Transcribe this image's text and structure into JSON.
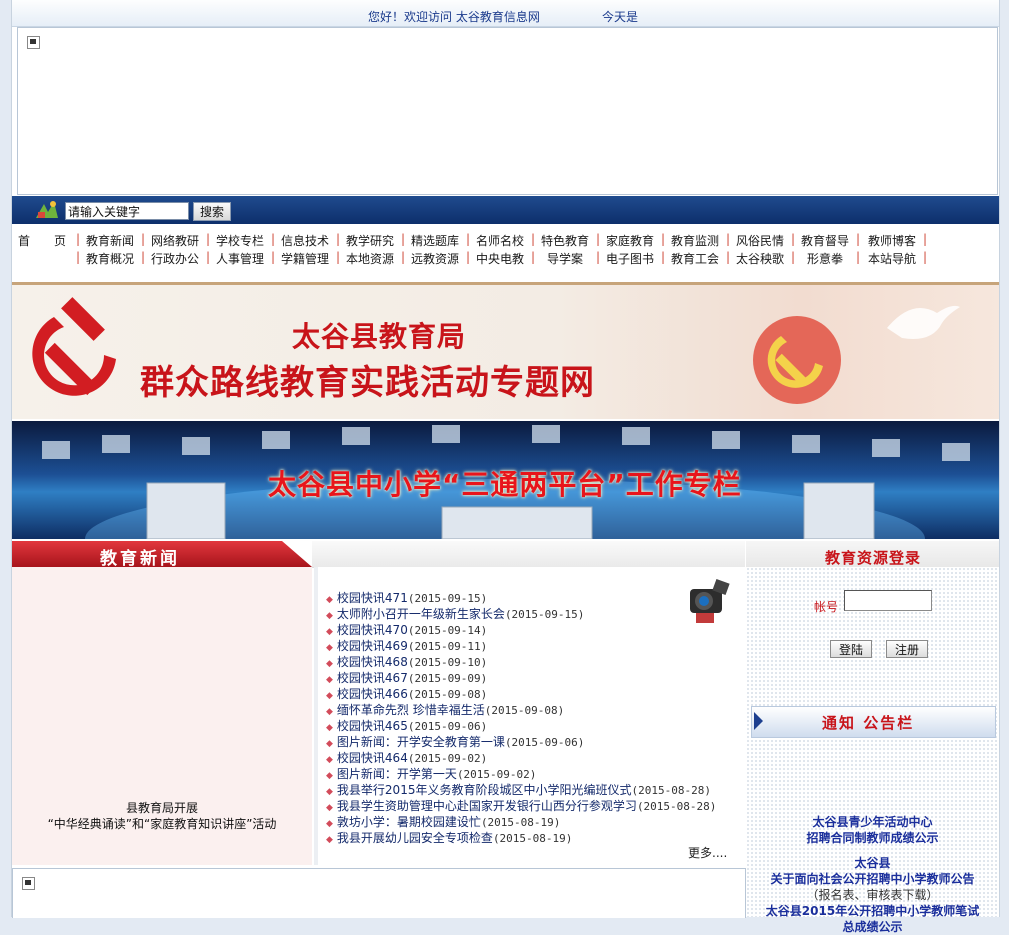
{
  "topbar": {
    "welcome": "您好！欢迎访问 太谷教育信息网",
    "today": "今天是"
  },
  "search": {
    "input_value": "请输入关键字",
    "button": "搜索"
  },
  "nav": {
    "row1": [
      "首　　页",
      "教育新闻",
      "网络教研",
      "学校专栏",
      "信息技术",
      "教学研究",
      "精选题库",
      "名师名校",
      "特色教育",
      "家庭教育",
      "教育监测",
      "风俗民情",
      "教育督导",
      "教师博客"
    ],
    "row2": [
      "教育概况",
      "行政办公",
      "人事管理",
      "学籍管理",
      "本地资源",
      "远教资源",
      "中央电教",
      "导学案",
      "电子图书",
      "教育工会",
      "太谷秧歌",
      "形意拳",
      "本站导航"
    ]
  },
  "banner1": {
    "line1": "太谷县教育局",
    "line2": "群众路线教育实践活动专题网"
  },
  "banner2": {
    "title": "太谷县中小学“三通两平台”工作专栏"
  },
  "news": {
    "header": "教育新闻",
    "caption_line1": "县教育局开展",
    "caption_line2": "“中华经典诵读”和“家庭教育知识讲座”活动",
    "items": [
      {
        "title": "校园快讯471",
        "date": "(2015-09-15)"
      },
      {
        "title": "太师附小召开一年级新生家长会",
        "date": "(2015-09-15)"
      },
      {
        "title": "校园快讯470",
        "date": "(2015-09-14)"
      },
      {
        "title": "校园快讯469",
        "date": "(2015-09-11)"
      },
      {
        "title": "校园快讯468",
        "date": "(2015-09-10)"
      },
      {
        "title": "校园快讯467",
        "date": "(2015-09-09)"
      },
      {
        "title": "校园快讯466",
        "date": "(2015-09-08)"
      },
      {
        "title": "缅怀革命先烈 珍惜幸福生活",
        "date": "(2015-09-08)"
      },
      {
        "title": "校园快讯465",
        "date": "(2015-09-06)"
      },
      {
        "title": "图片新闻：开学安全教育第一课",
        "date": "(2015-09-06)"
      },
      {
        "title": "校园快讯464",
        "date": "(2015-09-02)"
      },
      {
        "title": "图片新闻：开学第一天",
        "date": "(2015-09-02)"
      },
      {
        "title": "我县举行2015年义务教育阶段城区中小学阳光编班仪式",
        "date": "(2015-08-28)"
      },
      {
        "title": "我县学生资助管理中心赴国家开发银行山西分行参观学习",
        "date": "(2015-08-28)"
      },
      {
        "title": "敦坊小学：暑期校园建设忙",
        "date": "(2015-08-19)"
      },
      {
        "title": "我县开展幼儿园安全专项检查",
        "date": "(2015-08-19)"
      }
    ],
    "more": "更多...."
  },
  "resource": {
    "header": "教育资源登录",
    "account_label": "帐号",
    "account_value": "",
    "login": "登陆",
    "register": "注册"
  },
  "notice": {
    "header": "通知 公告栏",
    "n1_line1": "太谷县青少年活动中心",
    "n1_line2": "招聘合同制教师成绩公示",
    "n2_line1": "太谷县",
    "n2_line2": "关于面向社会公开招聘中小学教师公告",
    "n2_line3": "（报名表、审核表下载）",
    "n3_line1": "太谷县2015年公开招聘中小学教师笔试",
    "n3_line2": "总成绩公示"
  },
  "colors": {
    "brand_red": "#c8141a",
    "nav_blue": "#0d2f6b",
    "link_blue": "#142a6b"
  }
}
